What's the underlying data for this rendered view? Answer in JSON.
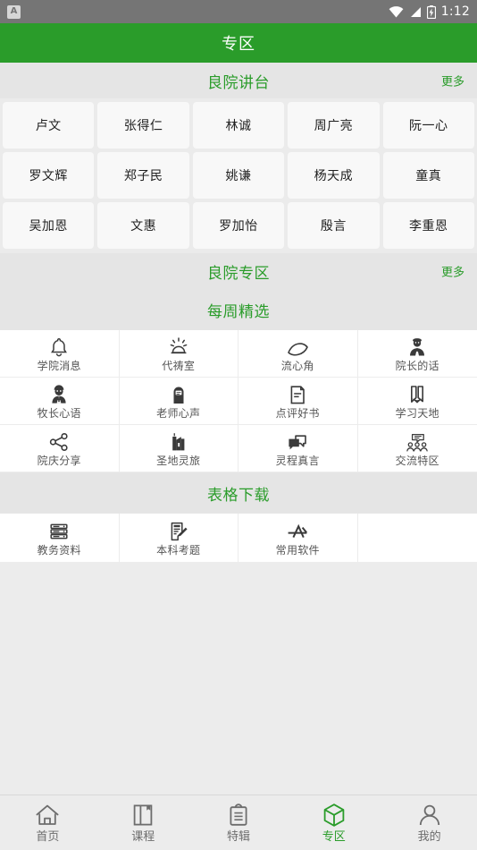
{
  "status_bar": {
    "notification_badge": "A",
    "time": "1:12",
    "icons": [
      "wifi-icon",
      "signal-icon",
      "battery-charging-icon"
    ]
  },
  "header": {
    "title": "专区",
    "background_color": "#2a9c2a",
    "text_color": "#ffffff"
  },
  "accent_color": "#2a9c2a",
  "sections": {
    "lecture": {
      "title": "良院讲台",
      "more_label": "更多",
      "chips": [
        "卢文",
        "张得仁",
        "林诚",
        "周广亮",
        "阮一心",
        "罗文辉",
        "郑子民",
        "姚谦",
        "杨天成",
        "童真",
        "吴加恩",
        "文惠",
        "罗加怡",
        "殷言",
        "李重恩"
      ]
    },
    "zone": {
      "title": "良院专区",
      "more_label": "更多"
    },
    "weekly": {
      "title": "每周精选",
      "items": [
        {
          "label": "学院消息",
          "icon": "bell-icon"
        },
        {
          "label": "代祷室",
          "icon": "lamp-light-icon"
        },
        {
          "label": "流心角",
          "icon": "fish-icon"
        },
        {
          "label": "院长的话",
          "icon": "person-suit-icon"
        },
        {
          "label": "牧长心语",
          "icon": "pastor-icon"
        },
        {
          "label": "老师心声",
          "icon": "teacher-icon"
        },
        {
          "label": "点评好书",
          "icon": "book-review-icon"
        },
        {
          "label": "学习天地",
          "icon": "pencil-book-icon"
        },
        {
          "label": "院庆分享",
          "icon": "share-icon"
        },
        {
          "label": "圣地灵旅",
          "icon": "church-icon"
        },
        {
          "label": "灵程真言",
          "icon": "speech-bubbles-icon"
        },
        {
          "label": "交流特区",
          "icon": "group-chat-icon"
        }
      ]
    },
    "download": {
      "title": "表格下载",
      "items": [
        {
          "label": "教务资料",
          "icon": "server-stack-icon"
        },
        {
          "label": "本科考题",
          "icon": "form-pencil-icon"
        },
        {
          "label": "常用软件",
          "icon": "appstore-icon"
        }
      ]
    }
  },
  "tabbar": {
    "active_index": 3,
    "tabs": [
      {
        "label": "首页",
        "icon": "home-icon"
      },
      {
        "label": "课程",
        "icon": "book-icon"
      },
      {
        "label": "特辑",
        "icon": "clipboard-icon"
      },
      {
        "label": "专区",
        "icon": "cube-icon"
      },
      {
        "label": "我的",
        "icon": "person-icon"
      }
    ]
  }
}
